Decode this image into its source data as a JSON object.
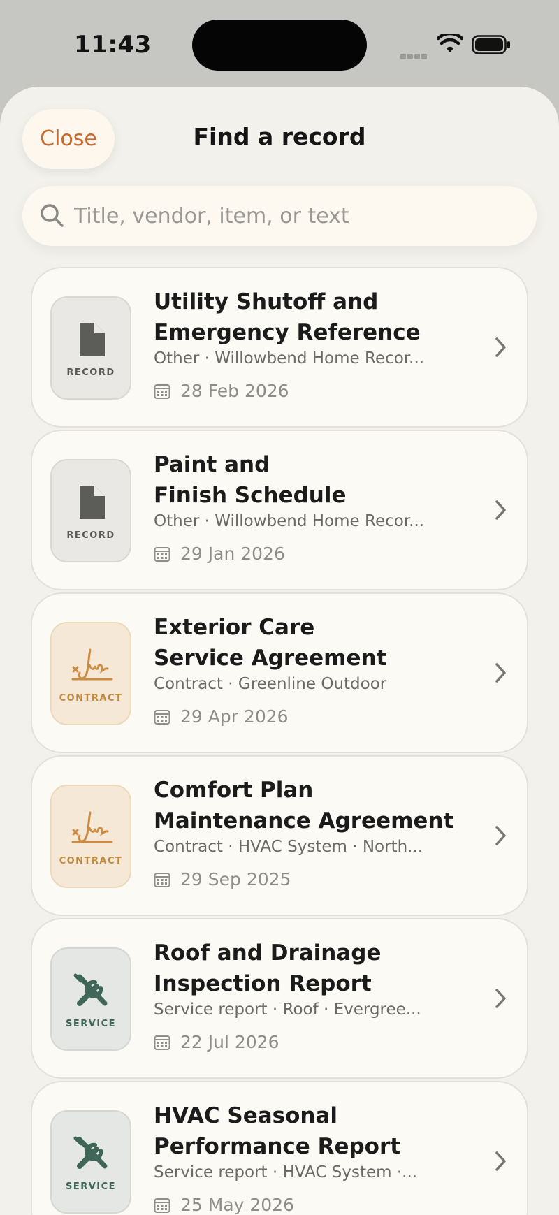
{
  "status": {
    "time": "11:43"
  },
  "header": {
    "close_label": "Close",
    "title": "Find a record"
  },
  "search": {
    "placeholder": "Title, vendor, item, or text",
    "value": ""
  },
  "records": [
    {
      "title_line1": "Utility Shutoff and",
      "title_line2": "Emergency Reference",
      "meta": "Other · Willowbend Home Recor...",
      "date": "28 Feb 2026",
      "badge": "RECORD",
      "icon": "document-icon"
    },
    {
      "title_line1": "Paint and",
      "title_line2": "Finish Schedule",
      "meta": "Other · Willowbend Home Recor...",
      "date": "29 Jan 2026",
      "badge": "RECORD",
      "icon": "document-icon"
    },
    {
      "title_line1": "Exterior Care",
      "title_line2": "Service Agreement",
      "meta": "Contract · Greenline Outdoor",
      "date": "29 Apr 2026",
      "badge": "CONTRACT",
      "icon": "signature-icon"
    },
    {
      "title_line1": "Comfort Plan",
      "title_line2": "Maintenance Agreement",
      "meta": "Contract · HVAC System · North...",
      "date": "29 Sep 2025",
      "badge": "CONTRACT",
      "icon": "signature-icon"
    },
    {
      "title_line1": "Roof and Drainage",
      "title_line2": "Inspection Report",
      "meta": "Service report · Roof · Evergree...",
      "date": "22 Jul 2026",
      "badge": "SERVICE",
      "icon": "tools-icon"
    },
    {
      "title_line1": "HVAC Seasonal",
      "title_line2": "Performance Report",
      "meta": "Service report · HVAC System ·...",
      "date": "25 May 2026",
      "badge": "SERVICE",
      "icon": "tools-icon"
    }
  ],
  "colors": {
    "accent": "#c76a30",
    "sheet_background": "#f3f1ec",
    "record_badge": "#5a5a57",
    "contract_badge": "#c08a3e",
    "service_badge": "#3f6658"
  }
}
